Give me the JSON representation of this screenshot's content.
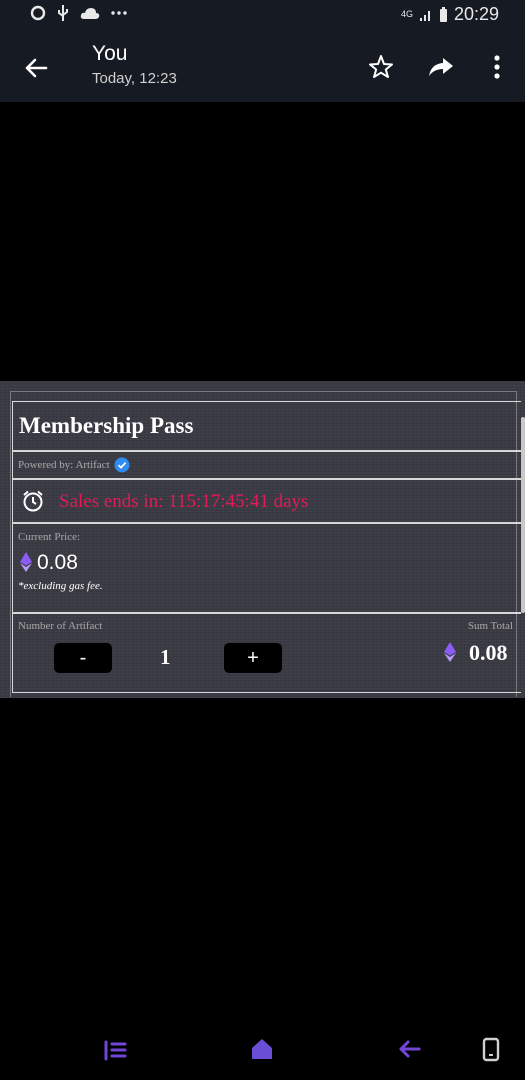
{
  "status_bar": {
    "time": "20:29",
    "network": "4G",
    "left_icons": [
      "o-icon",
      "usb-icon",
      "cloud-icon",
      "more-dots-icon"
    ]
  },
  "app_bar": {
    "title": "You",
    "subtitle": "Today, 12:23",
    "background": "#161a22"
  },
  "card": {
    "title": "Membership Pass",
    "powered_by": "Powered by: Artifact",
    "sales_text": "Sales ends in: 115:17:45:41 days",
    "sales_color": "#e21a55",
    "current_price_label": "Current Price:",
    "price": "0.08",
    "gas_note": "*excluding gas fee.",
    "link_text": "",
    "quantity_label": "Number of Artifact",
    "minus_label": "-",
    "quantity": "1",
    "plus_label": "+",
    "sum_label": "Sum Total",
    "sum_value": "0.08",
    "eth_color": "#8b5cf6"
  },
  "nav_bar": {
    "icons": [
      "recent-apps-icon",
      "home-icon",
      "back-icon",
      "screen-icon"
    ],
    "accent": "#6f46d6"
  }
}
